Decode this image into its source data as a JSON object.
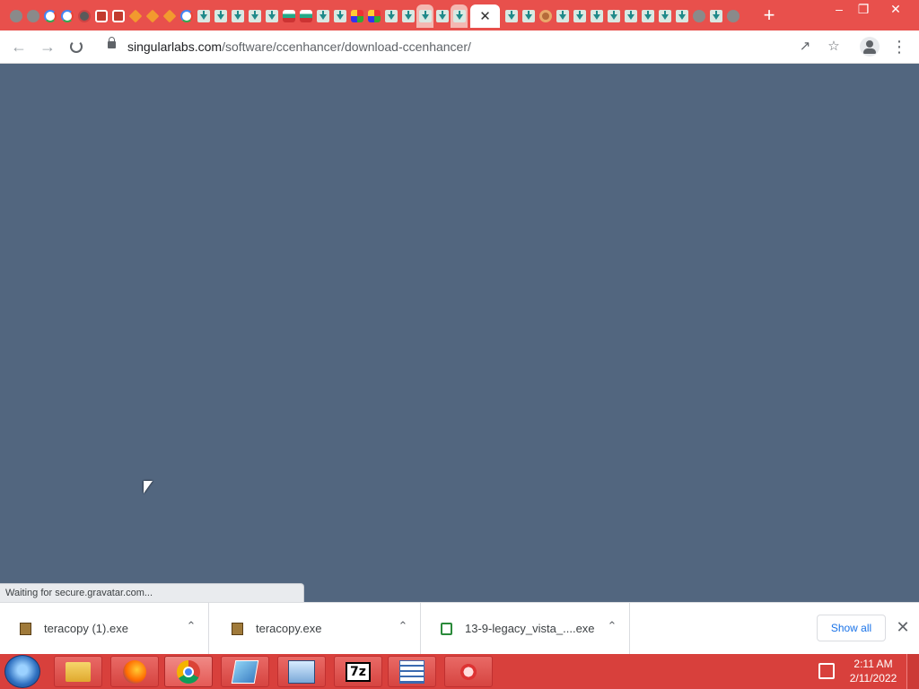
{
  "browser": {
    "url_host": "singularlabs.com",
    "url_path": "/software/ccenhancer/download-ccenhancer/",
    "status_text": "Waiting for secure.gravatar.com...",
    "tab_favicons": [
      "gray",
      "gray",
      "g",
      "g",
      "dark",
      "red",
      "red",
      "orange",
      "orange",
      "orange",
      "g",
      "dl",
      "dl",
      "dl",
      "dl",
      "dl",
      "bar",
      "bar",
      "dl",
      "dl",
      "multi",
      "multi",
      "dl",
      "dl",
      "dl-light",
      "dl",
      "dl-light",
      "active",
      "dl",
      "dl",
      "donut",
      "dl",
      "dl",
      "dl",
      "dl",
      "dl",
      "dl",
      "dl",
      "dl",
      "gray",
      "dl",
      "gray"
    ],
    "new_tab_label": "+",
    "window_controls": {
      "minimize": "–",
      "restore": "❐",
      "close": "✕"
    }
  },
  "downloads": {
    "items": [
      {
        "name": "teracopy (1).exe",
        "icon": "package-icon"
      },
      {
        "name": "teracopy.exe",
        "icon": "package-icon"
      },
      {
        "name": "13-9-legacy_vista_....exe",
        "icon": "amd-icon"
      }
    ],
    "show_all_label": "Show all"
  },
  "taskbar": {
    "apps": [
      "file-explorer",
      "firefox",
      "chrome",
      "app-tile",
      "control-panel",
      "7zip",
      "checklist",
      "app-red"
    ],
    "time": "2:11 AM",
    "date": "2/11/2022"
  },
  "colors": {
    "tabstrip": "#e8504c",
    "page_bg": "#52667f",
    "taskbar": "#d8403c",
    "link_blue": "#1a73e8"
  }
}
